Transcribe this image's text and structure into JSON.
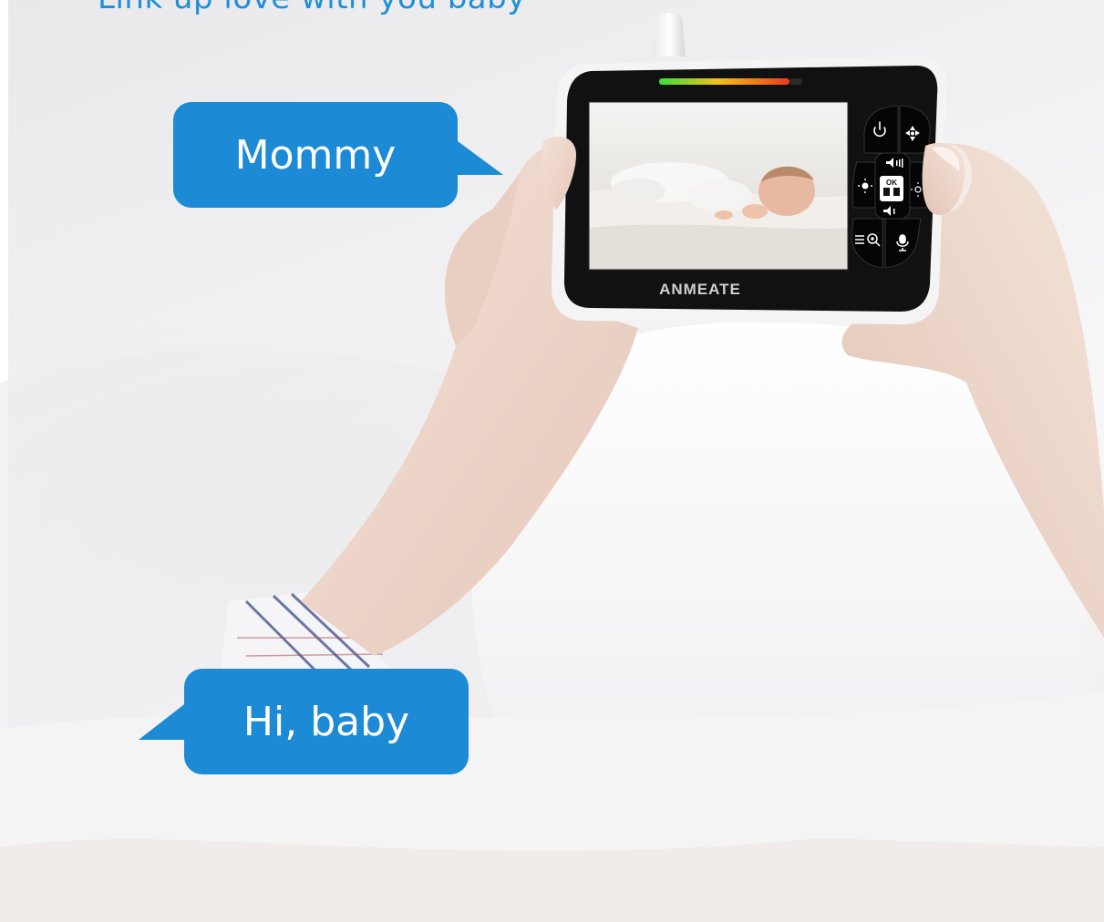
{
  "headline": "Link up love with you baby",
  "bubbles": {
    "top": "Mommy",
    "bottom": "Hi, baby"
  },
  "device": {
    "brand": "ANMEATE",
    "ok_label": "OK"
  },
  "colors": {
    "bubble_blue": "#1d8ad6",
    "headline_blue": "#1e8fd8",
    "device_body": "#111111",
    "device_frame": "#f4f4f4"
  },
  "icons": [
    "power-icon",
    "pan-tilt-icon",
    "volume-up-icon",
    "brightness-low-icon",
    "brightness-high-icon",
    "camera-switch-icon",
    "volume-down-icon",
    "menu-zoom-icon",
    "microphone-icon"
  ]
}
